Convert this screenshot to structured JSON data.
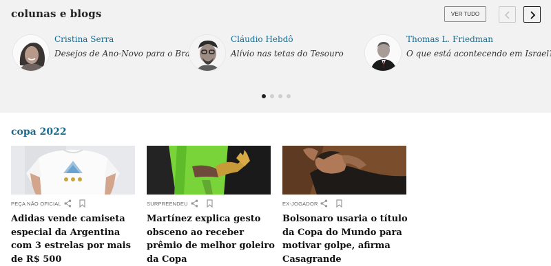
{
  "blogs": {
    "title": "colunas e blogs",
    "ver_tudo": "VER TUDO",
    "columnists": [
      {
        "name": "Cristina Serra",
        "subtitle": "Desejos de Ano-Novo para o Brasil"
      },
      {
        "name": "Cláudio Hebdô",
        "subtitle": "Alívio nas tetas do Tesouro"
      },
      {
        "name": "Thomas L. Friedman",
        "subtitle": "O que está acontecendo em Israel?"
      }
    ],
    "carousel_pages": 4,
    "active_page": 1
  },
  "copa": {
    "title": "copa 2022",
    "cards": [
      {
        "kicker": "PEÇA NÃO OFICIAL",
        "headline": "Adidas vende camiseta especial da Argentina com 3 estrelas por mais de R$ 500"
      },
      {
        "kicker": "SURPREENDEU",
        "headline": "Martínez explica gesto obsceno ao receber prêmio de melhor goleiro da Copa"
      },
      {
        "kicker": "EX-JOGADOR",
        "headline": "Bolsonaro usaria o título da Copa do Mundo para motivar golpe, afirma Casagrande"
      }
    ]
  },
  "colors": {
    "link": "#1a6b8f",
    "section_bg": "#f2f2f2"
  }
}
